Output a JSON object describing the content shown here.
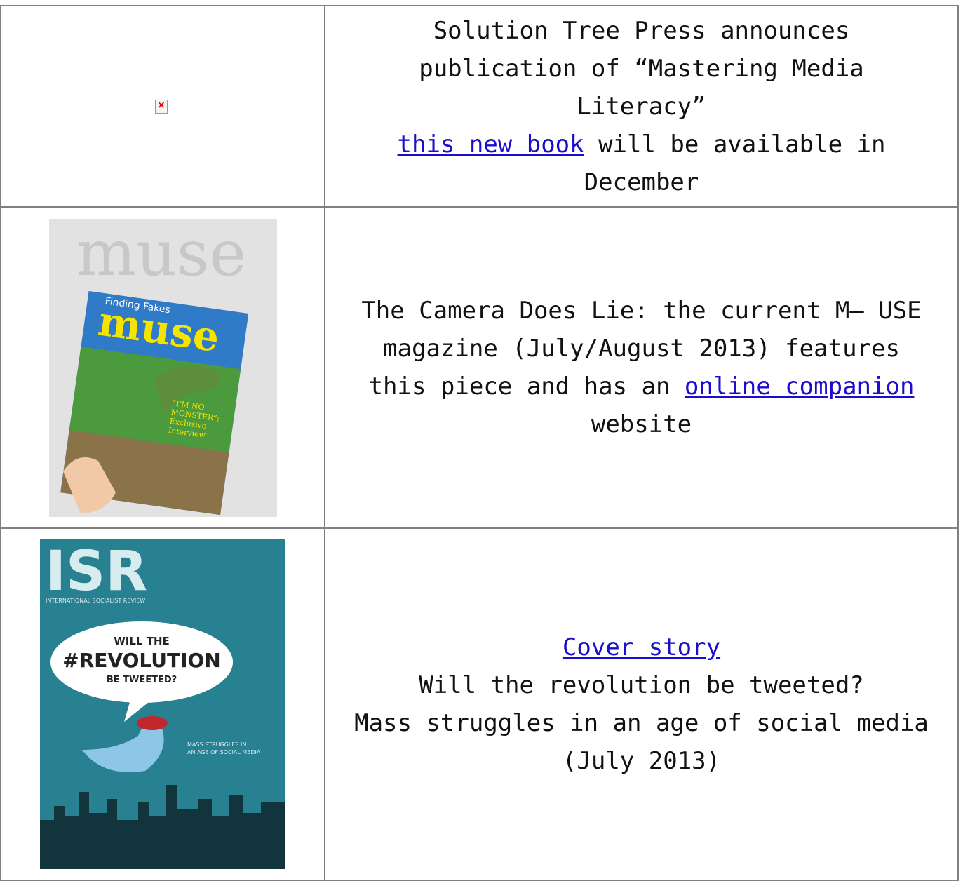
{
  "rows": [
    {
      "image": {
        "state": "broken",
        "icon": "broken-image-icon",
        "glyph": "×"
      },
      "line1": "Solution Tree Press announces",
      "line2": "publication of “Mastering Media",
      "line3": "Literacy”",
      "link": "this new book",
      "after_link": " will be available in",
      "line5": "December"
    },
    {
      "image": {
        "state": "loaded",
        "alt": "muse magazine cover",
        "cover_title": "muse",
        "cover_kicker": "Finding Fakes",
        "cover_blurb_1": "“I'M NO",
        "cover_blurb_2": "MONSTER”:",
        "cover_blurb_3": "Exclusive",
        "cover_blurb_4": "Interview"
      },
      "line1": "The Camera Does Lie: the current M— USE",
      "line2": "magazine (July/August 2013) features",
      "line3_before": "this piece and has an ",
      "link": "online companion",
      "line4": "website"
    },
    {
      "image": {
        "state": "loaded",
        "alt": "ISR magazine cover",
        "cover_title": "ISR",
        "cover_sub": "INTERNATIONAL SOCIALIST REVIEW",
        "bubble_1": "WILL THE",
        "bubble_2": "#REVOLUTION",
        "bubble_3": "BE TWEETED?",
        "side_1": "MASS STRUGGLES IN",
        "side_2": "AN AGE OF SOCIAL MEDIA"
      },
      "link": "Cover story",
      "line2": "Will the revolution be tweeted?",
      "line3": "Mass struggles in an age of social media",
      "line4": "(July 2013)"
    }
  ],
  "colors": {
    "link": "#1a0dcc",
    "border": "#808080",
    "isr_bg": "#2b8a9a",
    "muse_sky": "#3d7ec4"
  }
}
